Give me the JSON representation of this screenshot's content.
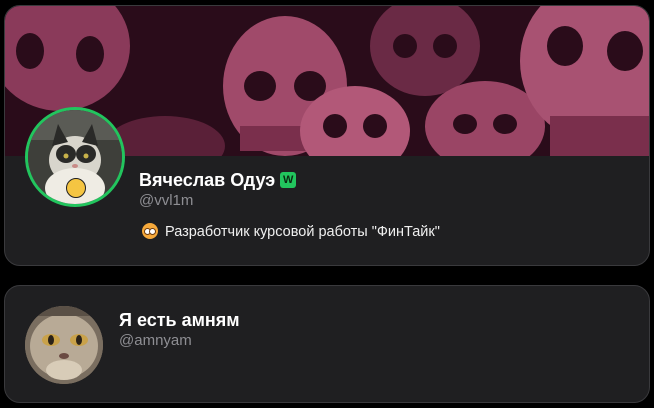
{
  "profiles": [
    {
      "name": "Вячеслав Одуэ",
      "handle": "@vvl1m",
      "badge": "W",
      "bio": "Разработчик курсовой работы \"ФинТайк\"",
      "banner_icon": "skulls-banner",
      "avatar_icon": "cat-avatar",
      "status_icon": "emoji-status-icon",
      "bio_icon": "flushed-face-icon",
      "accent_color": "#22c55e"
    },
    {
      "name": "Я есть амням",
      "handle": "@amnyam",
      "avatar_icon": "cat-avatar"
    }
  ],
  "colors": {
    "background": "#000000",
    "card": "#1f1f21",
    "card_border": "#3a3a3d",
    "banner": "#8a3a5a",
    "muted_text": "#8e8e93"
  }
}
